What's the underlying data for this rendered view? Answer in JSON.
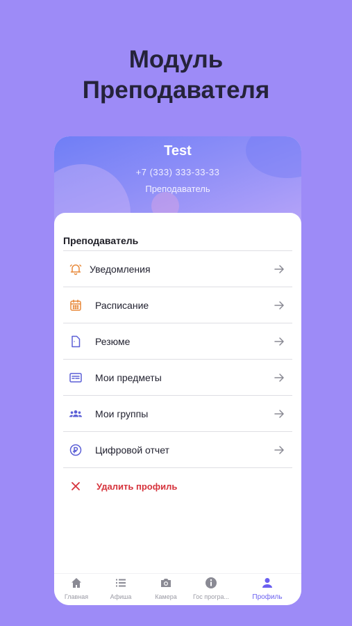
{
  "promo": {
    "title_line1": "Модуль",
    "title_line2": "Преподавателя"
  },
  "profile": {
    "name": "Test",
    "phone": "+7 (333) 333-33-33",
    "role": "Преподаватель"
  },
  "section": {
    "title": "Преподаватель"
  },
  "menu": {
    "items": [
      {
        "label": "Уведомления",
        "icon": "bell-icon"
      },
      {
        "label": "Расписание",
        "icon": "calendar-icon"
      },
      {
        "label": "Резюме",
        "icon": "document-icon"
      },
      {
        "label": "Мои предметы",
        "icon": "subjects-card-icon"
      },
      {
        "label": "Мои группы",
        "icon": "group-icon"
      },
      {
        "label": "Цифровой отчет",
        "icon": "report-icon"
      }
    ],
    "delete_label": "Удалить профиль"
  },
  "tabbar": {
    "tabs": [
      {
        "label": "Главная",
        "icon": "home-icon"
      },
      {
        "label": "Афиша",
        "icon": "list-icon"
      },
      {
        "label": "Камера",
        "icon": "camera-icon"
      },
      {
        "label": "Гос програ...",
        "icon": "info-icon"
      },
      {
        "label": "Профиль",
        "icon": "profile-icon",
        "active": true
      }
    ]
  },
  "colors": {
    "background": "#9d8bf7",
    "accent": "#6a5ff0",
    "icon_orange": "#e8893a",
    "icon_indigo": "#5b5fd6",
    "danger": "#d6333c"
  }
}
